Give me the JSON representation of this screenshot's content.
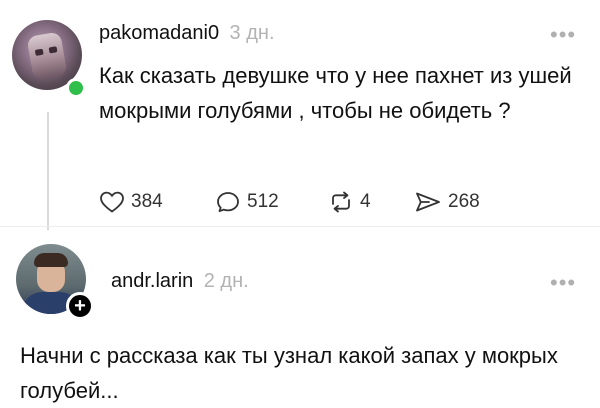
{
  "post": {
    "username": "pakomadani0",
    "time": "3 дн.",
    "more_icon": "more-horizontal-icon",
    "text": "Как сказать девушке что у нее пахнет из ушей мокрыми голубями , чтобы не обидеть ?",
    "online_color": "#2fbf4a",
    "actions": {
      "likes": "384",
      "comments": "512",
      "reposts": "4",
      "shares": "268"
    }
  },
  "reply": {
    "username": "andr.larin",
    "time": "2 дн.",
    "more_icon": "more-horizontal-icon",
    "follow_icon": "plus-icon",
    "text": "Начни с рассказа как ты узнал какой запах у мокрых голубей..."
  }
}
